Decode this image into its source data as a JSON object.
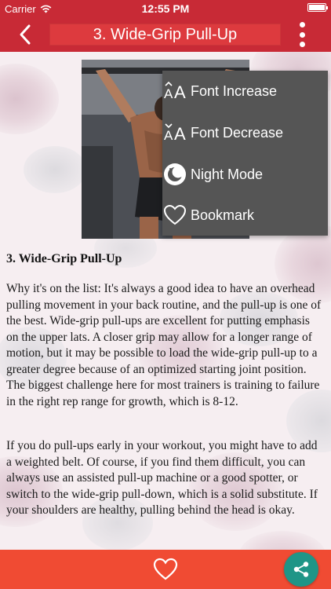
{
  "status_bar": {
    "carrier": "Carrier",
    "time": "12:55 PM",
    "battery_level": 1.0
  },
  "nav": {
    "title": "3. Wide-Grip Pull-Up",
    "back_icon": "chevron-left-icon",
    "more_icon": "more-vertical-icon"
  },
  "menu": {
    "items": [
      {
        "label": "Font Increase",
        "icon": "font-increase-icon"
      },
      {
        "label": "Font Decrease",
        "icon": "font-decrease-icon"
      },
      {
        "label": "Night Mode",
        "icon": "night-mode-icon"
      },
      {
        "label": "Bookmark",
        "icon": "heart-outline-icon"
      }
    ]
  },
  "article": {
    "heading": "3. Wide-Grip Pull-Up",
    "paragraphs": [
      "Why it's on the list: It's always a good idea to have an overhead pulling movement in your back routine, and the pull-up is one of the best. Wide-grip pull-ups are excellent for putting emphasis on the upper lats. A closer grip may allow for a longer range of motion, but it may be possible to load the wide-grip pull-up to a greater degree because of an optimized starting joint position. The biggest challenge here for most trainers is training to failure in the right rep range for growth, which is 8-12.",
      "If you do pull-ups early in your workout, you might have to add a weighted belt. Of course, if you find them difficult, you can always use an assisted pull-up machine or a good spotter, or switch to the wide-grip pull-down, which is a solid substitute. If your shoulders are healthy, pulling behind the head is okay."
    ]
  },
  "bottom_bar": {
    "heart_icon": "heart-outline-icon",
    "share_icon": "share-icon"
  },
  "colors": {
    "nav_background": "#c82a36",
    "title_background": "#dd3a3e",
    "menu_background": "#555555",
    "bottom_bar": "#f04b33",
    "share_button": "#1f9587"
  }
}
